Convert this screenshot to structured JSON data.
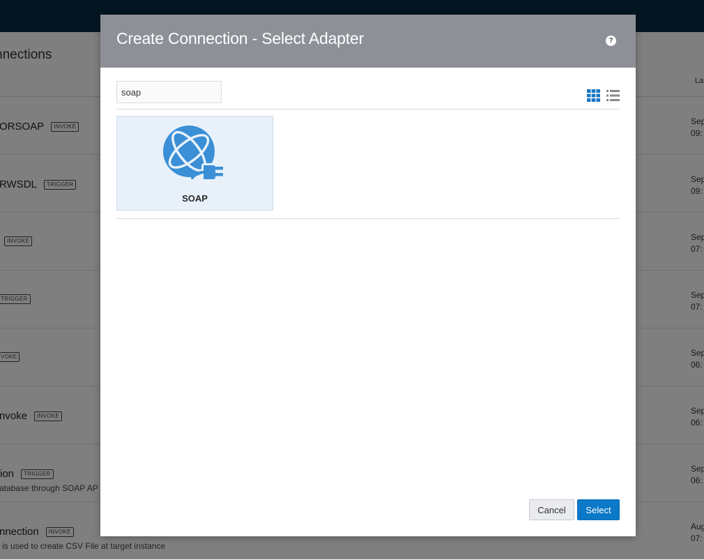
{
  "background": {
    "page_title": "nnections",
    "column_header": "La",
    "rows": [
      {
        "name": "ORSOAP",
        "badge": "INVOKE",
        "desc": "",
        "date1": "Sep",
        "date2": "09:"
      },
      {
        "name": "RWSDL",
        "badge": "TRIGGER",
        "desc": "",
        "date1": "Sep",
        "date2": "09:"
      },
      {
        "name": "",
        "badge": "INVOKE",
        "desc": "",
        "date1": "Sep",
        "date2": "07:"
      },
      {
        "name": "",
        "badge": "TRIGGER",
        "desc": "",
        "date1": "Sep",
        "date2": "07:"
      },
      {
        "name": "",
        "badge": "VOKE",
        "desc": "",
        "date1": "Sep",
        "date2": "06:"
      },
      {
        "name": "nvoke",
        "badge": "INVOKE",
        "desc": "",
        "date1": "Sep",
        "date2": "06:"
      },
      {
        "name": "ion",
        "badge": "TRIGGER",
        "desc": "atabase through SOAP AP",
        "date1": "Sep",
        "date2": "06:"
      },
      {
        "name": "nnection",
        "badge": "INVOKE",
        "desc": "is used to create CSV File at target instance",
        "date1": "Aug",
        "date2": "07:"
      }
    ]
  },
  "dialog": {
    "title": "Create Connection - Select Adapter",
    "help_icon": "?",
    "search": {
      "value": "soap",
      "placeholder": ""
    },
    "view_icons": {
      "grid": "grid-view-icon",
      "list": "list-view-icon"
    },
    "adapters": [
      {
        "label": "SOAP",
        "icon": "soap-adapter-icon"
      }
    ],
    "cancel_label": "Cancel",
    "select_label": "Select"
  },
  "colors": {
    "topbar": "#0b2c47",
    "dialog_header": "#8e9098",
    "accent_blue": "#0b78c8",
    "card_bg": "#e8f1fa",
    "icon_blue": "#3a8fd6",
    "grid_icon_blue": "#1b77c4",
    "list_icon_gray": "#8a8a8a"
  }
}
